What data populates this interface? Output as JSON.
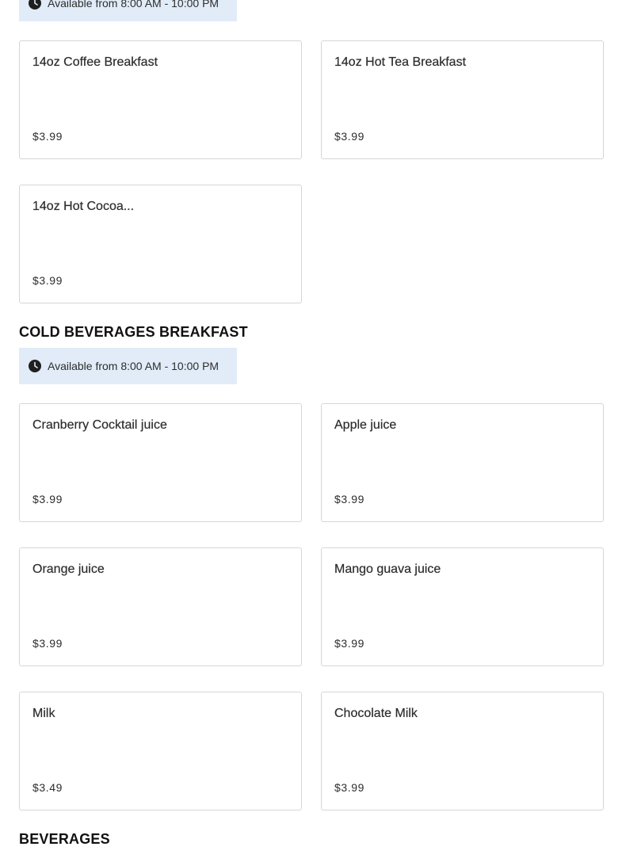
{
  "top_availability": "Available from 8:00 AM - 10:00 PM",
  "hot_items": [
    {
      "name": "14oz Coffee Breakfast",
      "price": "$3.99"
    },
    {
      "name": "14oz Hot Tea Breakfast",
      "price": "$3.99"
    },
    {
      "name": "14oz Hot Cocoa...",
      "price": "$3.99"
    }
  ],
  "cold_section": {
    "title": "COLD BEVERAGES BREAKFAST",
    "availability": "Available from 8:00 AM - 10:00 PM",
    "items": [
      {
        "name": "Cranberry Cocktail juice",
        "price": "$3.99"
      },
      {
        "name": "Apple juice",
        "price": "$3.99"
      },
      {
        "name": "Orange juice",
        "price": "$3.99"
      },
      {
        "name": "Mango guava juice",
        "price": "$3.99"
      },
      {
        "name": "Milk",
        "price": "$3.49"
      },
      {
        "name": "Chocolate Milk",
        "price": "$3.99"
      }
    ]
  },
  "beverages_section": {
    "title": "BEVERAGES"
  },
  "icons": {
    "availability": "clock-icon"
  }
}
